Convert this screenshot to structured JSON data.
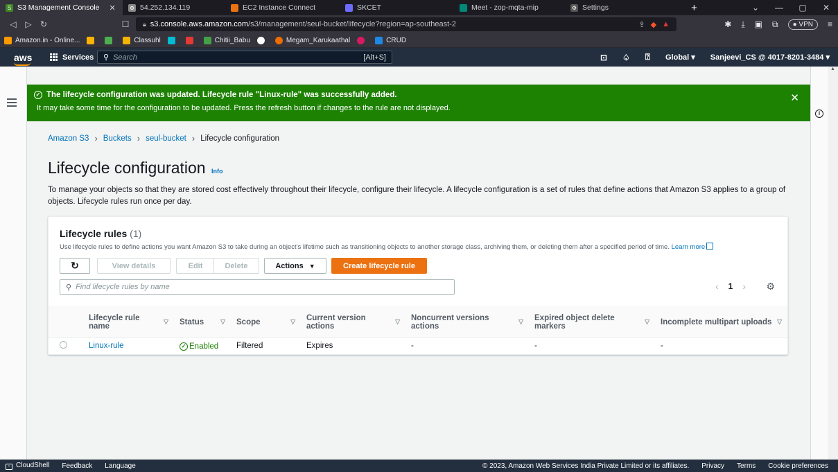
{
  "browser": {
    "tabs": [
      {
        "label": "S3 Management Console",
        "active": true,
        "color": "#3f8624"
      },
      {
        "label": "54.252.134.119",
        "active": false,
        "color": "#888888"
      },
      {
        "label": "EC2 Instance Connect",
        "active": false,
        "color": "#ec7211"
      },
      {
        "label": "SKCET",
        "active": false,
        "color": "#6c6cff"
      },
      {
        "label": "Meet - zop-mqta-mip",
        "active": false,
        "color": "#00897b"
      },
      {
        "label": "Settings",
        "active": false,
        "color": "#999999"
      }
    ],
    "url_host": "s3.console.aws.amazon.com",
    "url_path": "/s3/management/seul-bucket/lifecycle?region=ap-southeast-2",
    "vpn_label": "VPN",
    "bookmarks": [
      {
        "label": "Amazon.in - Online...",
        "color": "#ff9900"
      },
      {
        "label": "",
        "color": "#ffb300"
      },
      {
        "label": "",
        "color": "#4caf50"
      },
      {
        "label": "Classuhl",
        "color": "#f4b400"
      },
      {
        "label": "",
        "color": "#00bcd4"
      },
      {
        "label": "",
        "color": "#e53935"
      },
      {
        "label": "Chitii_Babu",
        "color": "#43a047"
      },
      {
        "label": "",
        "color": "#ffffff"
      },
      {
        "label": "Megam_Karukaathal",
        "color": "#ef6c00"
      },
      {
        "label": "",
        "color": "#d81b60"
      },
      {
        "label": "CRUD",
        "color": "#1e88e5"
      }
    ]
  },
  "aws": {
    "logo": "aws",
    "services_label": "Services",
    "search_placeholder": "Search",
    "search_shortcut": "[Alt+S]",
    "region": "Global",
    "account": "Sanjeevi_CS @ 4017-8201-3484"
  },
  "flash": {
    "title": "The lifecycle configuration was updated. Lifecycle rule \"Linux-rule\" was successfully added.",
    "message": "It may take some time for the configuration to be updated. Press the refresh button if changes to the rule are not displayed.",
    "color": "#1d8102"
  },
  "breadcrumb": [
    "Amazon S3",
    "Buckets",
    "seul-bucket",
    "Lifecycle configuration"
  ],
  "page": {
    "title": "Lifecycle configuration",
    "info_label": "Info",
    "description": "To manage your objects so that they are stored cost effectively throughout their lifecycle, configure their lifecycle. A lifecycle configuration is a set of rules that define actions that Amazon S3 applies to a group of objects. Lifecycle rules run once per day."
  },
  "rules_panel": {
    "heading": "Lifecycle rules",
    "count": "(1)",
    "note": "Use lifecycle rules to define actions you want Amazon S3 to take during an object's lifetime such as transitioning objects to another storage class, archiving them, or deleting them after a specified period of time.",
    "learn_more": "Learn more",
    "buttons": {
      "view_details": "View details",
      "edit": "Edit",
      "delete": "Delete",
      "actions": "Actions",
      "create": "Create lifecycle rule"
    },
    "filter_placeholder": "Find lifecycle rules by name",
    "page_number": "1",
    "columns": [
      "Lifecycle rule name",
      "Status",
      "Scope",
      "Current version actions",
      "Noncurrent versions actions",
      "Expired object delete markers",
      "Incomplete multipart uploads"
    ],
    "rows": [
      {
        "name": "Linux-rule",
        "status": "Enabled",
        "scope": "Filtered",
        "current": "Expires",
        "noncurrent": "-",
        "expired": "-",
        "incomplete": "-"
      }
    ]
  },
  "footer": {
    "cloudshell": "CloudShell",
    "feedback": "Feedback",
    "language": "Language",
    "copyright": "© 2023, Amazon Web Services India Private Limited or its affiliates.",
    "privacy": "Privacy",
    "terms": "Terms",
    "cookies": "Cookie preferences"
  }
}
